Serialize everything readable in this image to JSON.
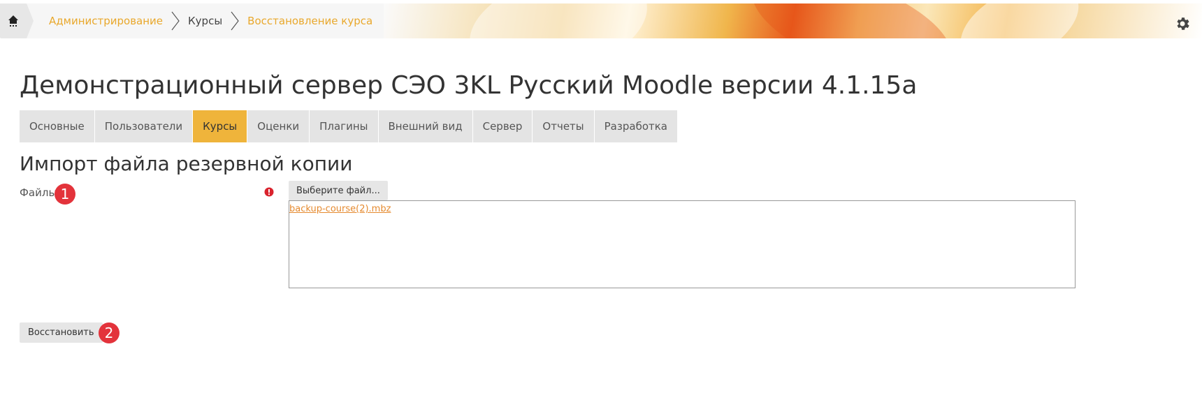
{
  "breadcrumb": {
    "items": [
      {
        "label": "Администрирование",
        "link": true
      },
      {
        "label": "Курсы",
        "link": false
      },
      {
        "label": "Восстановление курса",
        "link": true
      }
    ]
  },
  "header": {
    "title": "Демонстрационный сервер СЭО 3KL Русский Moodle версии 4.1.15a"
  },
  "tabs": [
    {
      "label": "Основные"
    },
    {
      "label": "Пользователи"
    },
    {
      "label": "Курсы"
    },
    {
      "label": "Оценки"
    },
    {
      "label": "Плагины"
    },
    {
      "label": "Внешний вид"
    },
    {
      "label": "Сервер"
    },
    {
      "label": "Отчеты"
    },
    {
      "label": "Разработка"
    }
  ],
  "active_tab": "Курсы",
  "section": {
    "title": "Импорт файла резервной копии"
  },
  "form": {
    "files_label": "Файлы",
    "choose_button": "Выберите файл...",
    "selected_file": "backup-course(2).mbz",
    "restore_button": "Восстановить"
  },
  "badges": {
    "first": "1",
    "second": "2"
  },
  "colors": {
    "accent": "#efb43b",
    "link": "#e9a82c",
    "file_link": "#e58a2f",
    "badge": "#e3333b",
    "required": "#d9232d"
  },
  "icons": {
    "home": "home-icon",
    "settings": "gear-icon",
    "required": "exclamation-circle-icon"
  }
}
